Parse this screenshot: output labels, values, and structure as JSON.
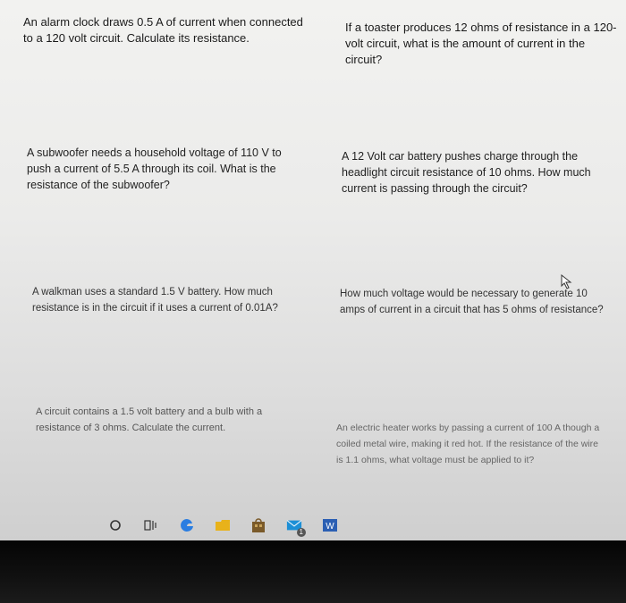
{
  "questions": [
    {
      "text": "An alarm clock draws 0.5 A of current when connected to a 120 volt circuit. Calculate its resistance."
    },
    {
      "text": "If a toaster produces 12 ohms of resistance in a 120-volt circuit, what is the amount of current in the circuit?"
    },
    {
      "text": "A subwoofer needs a household voltage of 110 V to push a current of 5.5 A through its coil. What is the resistance of the subwoofer?"
    },
    {
      "text": "A 12 Volt car battery pushes charge through the headlight circuit resistance of 10 ohms. How much current is passing through the circuit?"
    },
    {
      "text": "A walkman uses a standard 1.5 V battery. How much resistance is in the circuit if it uses a current of 0.01A?"
    },
    {
      "text": "How much voltage would be necessary to generate 10 amps of current in a circuit that has 5 ohms of resistance?"
    },
    {
      "text": "A circuit contains a 1.5 volt battery and a bulb with a resistance of 3 ohms. Calculate the current."
    },
    {
      "text": "An electric heater works by passing a current of 100 A though a coiled metal wire, making it red hot. If the resistance of the wire is 1.1 ohms, what voltage must be applied to it?"
    }
  ],
  "taskbar": {
    "icons": [
      "search-circle-icon",
      "task-view-icon",
      "edge-browser-icon",
      "file-explorer-icon",
      "store-icon",
      "mail-icon",
      "word-icon"
    ],
    "mail_badge": "1"
  },
  "colors": {
    "edge": "#2a7de1",
    "explorer": "#e8b21a",
    "store": "#7a5a2a",
    "mail": "#1c8fd6",
    "word": "#2b5fb3"
  }
}
